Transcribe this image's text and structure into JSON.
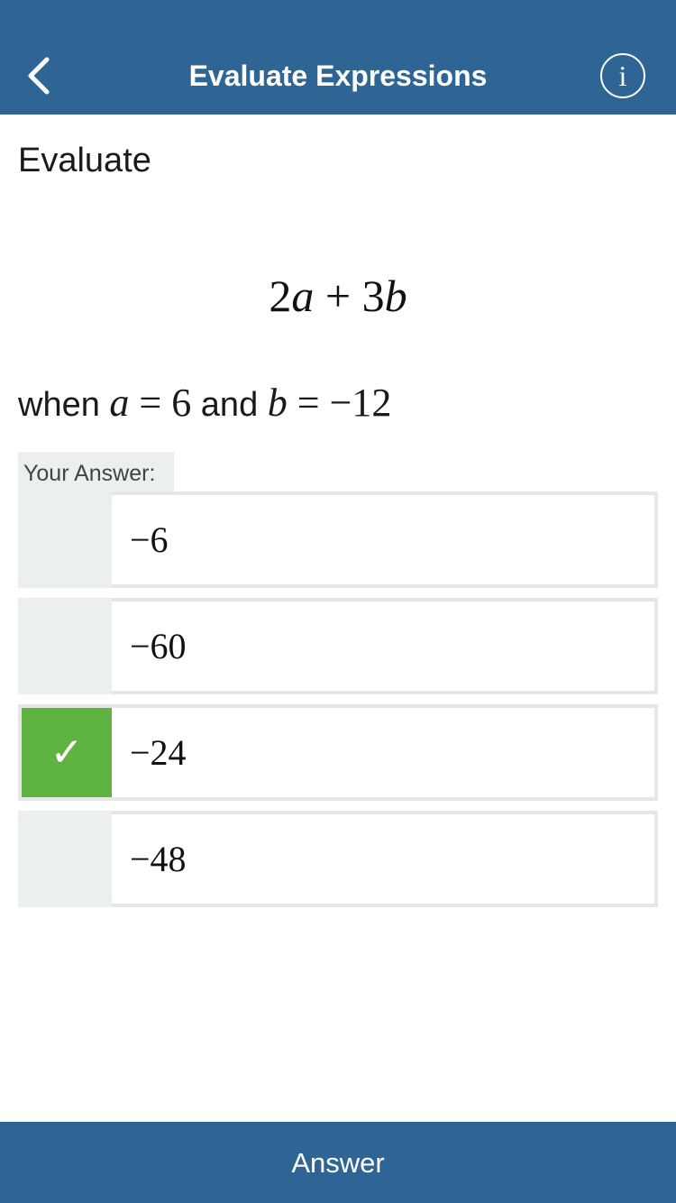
{
  "header": {
    "title": "Evaluate Expressions",
    "back_icon": "chevron-left-icon",
    "info_icon": "info-icon",
    "info_glyph": "i",
    "color": "#2f6595"
  },
  "question": {
    "prompt": "Evaluate",
    "expression": {
      "coef_a": "2",
      "var_a": "a",
      "operator": "+",
      "coef_b": "3",
      "var_b": "b"
    },
    "condition": {
      "when": "when",
      "var_a": "a",
      "eq": "=",
      "val_a": "6",
      "and": "and",
      "var_b": "b",
      "val_b": "−12"
    }
  },
  "answer": {
    "label": "Your Answer:",
    "options": [
      {
        "value": "−6",
        "selected": false
      },
      {
        "value": "−60",
        "selected": false
      },
      {
        "value": "−24",
        "selected": true,
        "mark": "✓"
      },
      {
        "value": "−48",
        "selected": false
      }
    ],
    "selected_color": "#5fb340"
  },
  "footer": {
    "button_label": "Answer"
  }
}
